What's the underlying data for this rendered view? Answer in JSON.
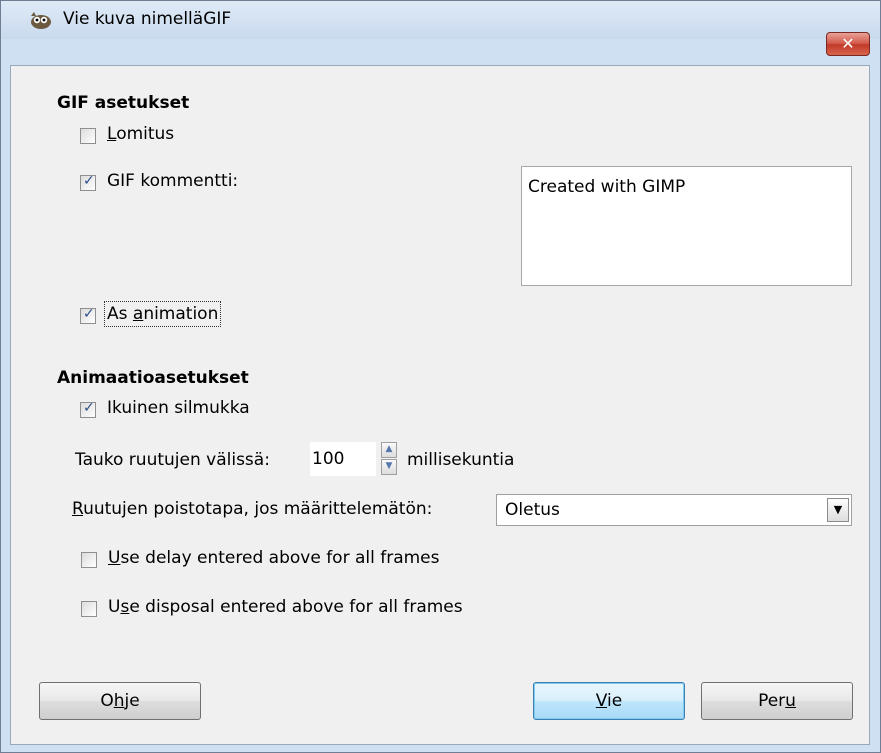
{
  "window": {
    "title": "Vie kuva nimelläGIF",
    "close_label": "✕"
  },
  "gif_settings": {
    "heading": "GIF asetukset",
    "interlace": {
      "label_pre": "",
      "label_u": "L",
      "label_post": "omitus",
      "checked": false
    },
    "comment": {
      "label": "GIF kommentti:",
      "checked": true,
      "value": "Created with GIMP"
    },
    "as_animation": {
      "label_pre": "As ",
      "label_u": "a",
      "label_post": "nimation",
      "checked": true
    }
  },
  "animation_settings": {
    "heading": "Animaatioasetukset",
    "loop": {
      "label": "Ikuinen silmukka",
      "checked": true
    },
    "delay": {
      "label": "Tauko ruutujen välissä:",
      "value": "100",
      "unit": "millisekuntia"
    },
    "disposal": {
      "label_u": "R",
      "label_post": "uutujen poistotapa, jos määrittelemätön:",
      "value": "Oletus"
    },
    "use_delay_all": {
      "label_u": "U",
      "label_post": "se delay entered above for all frames",
      "checked": false
    },
    "use_disposal_all": {
      "label_pre": "U",
      "label_u": "s",
      "label_post": "e disposal entered above for all frames",
      "checked": false
    }
  },
  "buttons": {
    "help": {
      "pre": "O",
      "u": "h",
      "post": "je"
    },
    "export": {
      "pre": "",
      "u": "V",
      "post": "ie"
    },
    "cancel": {
      "pre": "Per",
      "u": "u",
      "post": ""
    }
  },
  "icons": {
    "app": "gimp-wilber-icon",
    "close": "close-icon",
    "checkmark": "checkmark-icon",
    "spin_up": "spin-up-icon",
    "spin_down": "spin-down-icon",
    "dropdown": "chevron-down-icon"
  }
}
